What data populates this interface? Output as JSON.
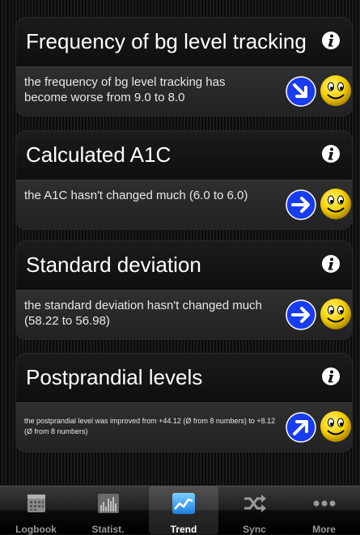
{
  "cards": [
    {
      "title": "Frequency of bg level tracking",
      "text": "the frequency of bg level tracking has become worse from 9.0 to 8.0",
      "trend": "arrow-down-right-icon"
    },
    {
      "title": "Calculated A1C",
      "text": "the A1C hasn't changed much (6.0 to 6.0)",
      "trend": "arrow-right-icon"
    },
    {
      "title": "Standard deviation",
      "text": "the standard deviation hasn't changed much (58.22 to 56.98)",
      "trend": "arrow-right-icon"
    },
    {
      "title": "Postprandial levels",
      "text": "the postprandial level was improved from +44.12  (Ø from 8 numbers) to +8.12  (Ø from 8 numbers)",
      "trend": "arrow-up-right-icon"
    }
  ],
  "tabs": [
    {
      "label": "Logbook",
      "icon": "calendar-icon"
    },
    {
      "label": "Statist.",
      "icon": "bar-chart-icon"
    },
    {
      "label": "Trend",
      "icon": "trend-line-icon",
      "active": true
    },
    {
      "label": "Sync",
      "icon": "shuffle-icon"
    },
    {
      "label": "More",
      "icon": "more-dots-icon"
    }
  ],
  "colors": {
    "arrow_blue": "#1a3cf0",
    "smiley_yellow": "#f5d100"
  }
}
